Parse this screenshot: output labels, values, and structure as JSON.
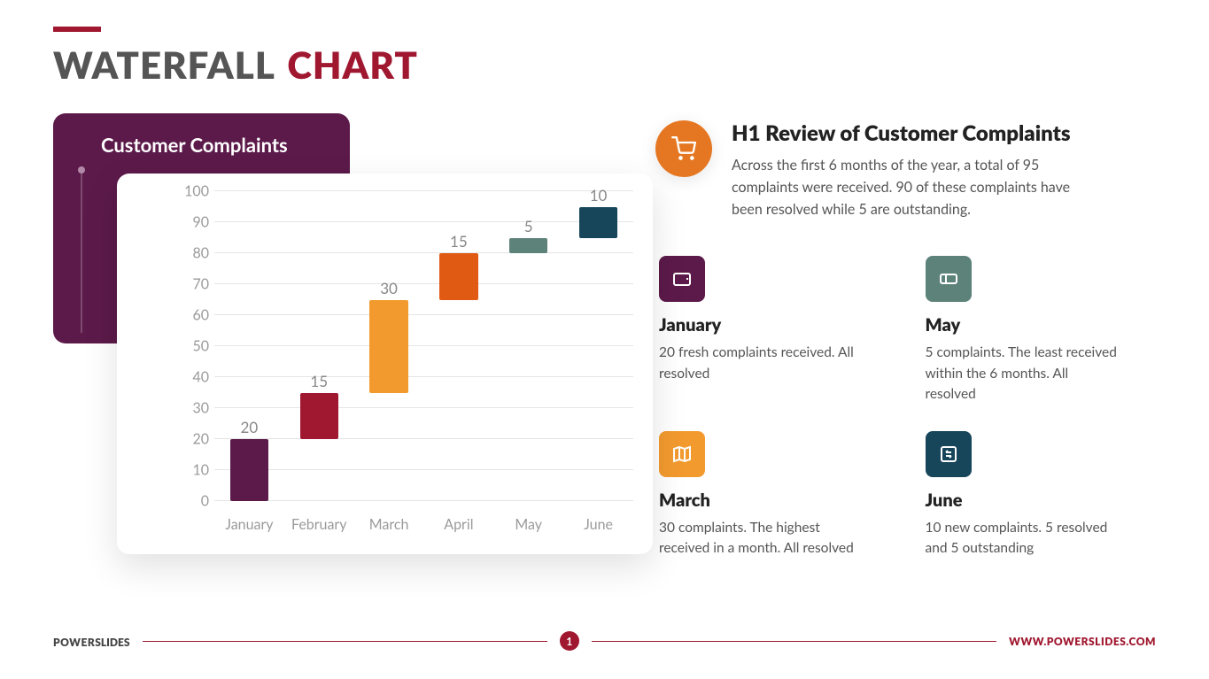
{
  "title": {
    "a": "WATERFALL",
    "b": "CHART"
  },
  "chart_panel": {
    "title": "Customer Complaints"
  },
  "chart_data": {
    "type": "bar",
    "subtype": "waterfall",
    "title": "Customer Complaints",
    "ylabel": "",
    "xlabel": "",
    "ylim": [
      0,
      100
    ],
    "yticks": [
      0,
      10,
      20,
      30,
      40,
      50,
      60,
      70,
      80,
      90,
      100
    ],
    "categories": [
      "January",
      "February",
      "March",
      "April",
      "May",
      "June"
    ],
    "values": [
      20,
      15,
      30,
      15,
      5,
      10
    ],
    "cumulative_end": [
      20,
      35,
      65,
      80,
      85,
      95
    ],
    "colors": [
      "#5c1a4a",
      "#a01830",
      "#f29a2e",
      "#e05a14",
      "#5d827a",
      "#17455a"
    ]
  },
  "review": {
    "title": "H1 Review of Customer Complaints",
    "body": "Across the first 6 months of the year, a total of 95 complaints were received. 90 of these complaints have been resolved while 5 are outstanding."
  },
  "details": [
    {
      "month": "January",
      "body": "20 fresh complaints received. All resolved",
      "icon": "wallet-icon",
      "color": "#5c1a4a"
    },
    {
      "month": "May",
      "body": "5 complaints. The least received within the 6 months. All resolved",
      "icon": "ticket-icon",
      "color": "#5d827a"
    },
    {
      "month": "March",
      "body": "30 complaints. The highest received in a month. All resolved",
      "icon": "map-icon",
      "color": "#f29a2e"
    },
    {
      "month": "June",
      "body": "10 new complaints. 5 resolved and 5 outstanding",
      "icon": "swap-icon",
      "color": "#17455a"
    }
  ],
  "footer": {
    "brand_a": "POWER",
    "brand_b": "SLIDES",
    "page": "1",
    "site": "WWW.POWERSLIDES.COM"
  }
}
